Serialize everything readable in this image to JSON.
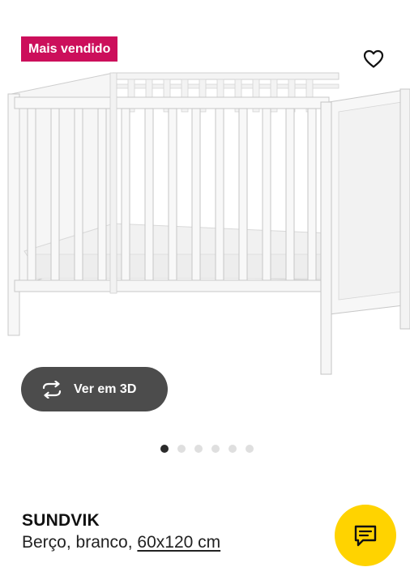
{
  "product": {
    "badge": "Mais vendido",
    "name": "SUNDVIK",
    "description_prefix": "Berço, branco, ",
    "size_link": "60x120 cm"
  },
  "gallery": {
    "view3d_label": "Ver em 3D",
    "image_count": 6,
    "active_index": 0
  },
  "icons": {
    "favorite": "heart-outline-icon",
    "view3d": "rotate-arrows-icon",
    "chat": "chat-bubble-icon"
  },
  "colors": {
    "badge_bg": "#cc0f5b",
    "button_3d_bg": "#4c4c4c",
    "chat_bg": "#ffd300",
    "dot_active": "#2a2a2a",
    "dot_inactive": "#dfdfdf"
  }
}
